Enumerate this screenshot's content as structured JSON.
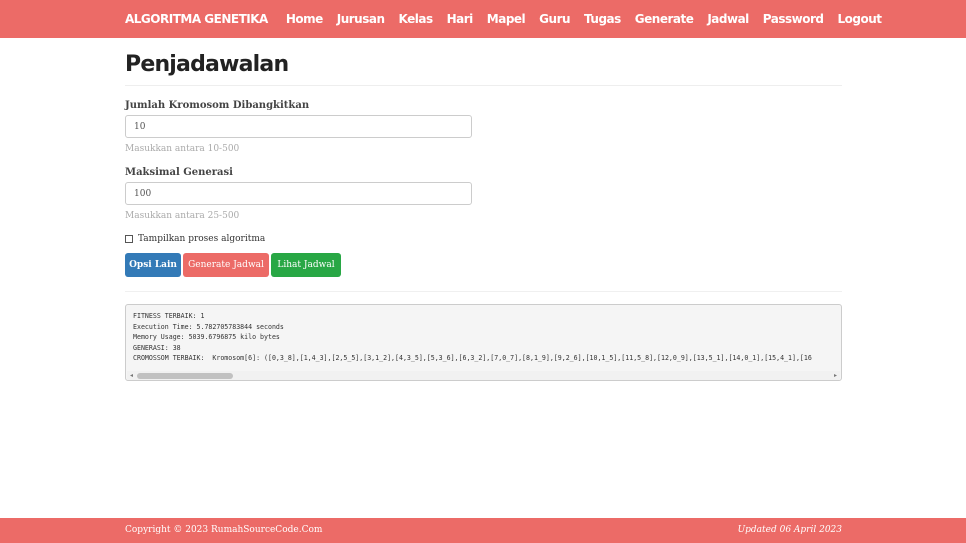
{
  "navbar": {
    "brand": "ALGORITMA GENETIKA",
    "links": [
      "Home",
      "Jurusan",
      "Kelas",
      "Hari",
      "Mapel",
      "Guru",
      "Tugas",
      "Generate",
      "Jadwal",
      "Password",
      "Logout"
    ]
  },
  "page": {
    "title": "Penjadawalan"
  },
  "form": {
    "kromosom": {
      "label": "Jumlah Kromosom Dibangkitkan",
      "value": "10",
      "help": "Masukkan antara 10-500"
    },
    "generasi": {
      "label": "Maksimal Generasi",
      "value": "100",
      "help": "Masukkan antara 25-500"
    },
    "checkbox_label": "Tampilkan proses algoritma",
    "buttons": {
      "opsi": "Opsi Lain",
      "generate": "Generate Jadwal",
      "lihat": "Lihat Jadwal"
    }
  },
  "output": {
    "lines": [
      "FITNESS TERBAIK: 1",
      "Execution Time: 5.782705783844 seconds",
      "Memory Usage: 5039.6796875 kilo bytes",
      "GENERASI: 38",
      "CROMOSSOM TERBAIK:  Kromosom[6]: ([0,3_8],[1,4_3],[2,5_5],[3,1_2],[4,3_5],[5,3_6],[6,3_2],[7,0_7],[8,1_9],[9,2_6],[10,1_5],[11,5_8],[12,0_9],[13,5_1],[14,0_1],[15,4_1],[16"
    ]
  },
  "footer": {
    "copyright": "Copyright © 2023 RumahSourceCode.Com",
    "updated": "Updated 06 April 2023"
  },
  "colors": {
    "primary": "#ec6b67",
    "blue": "#337ab7",
    "green": "#28a745"
  }
}
